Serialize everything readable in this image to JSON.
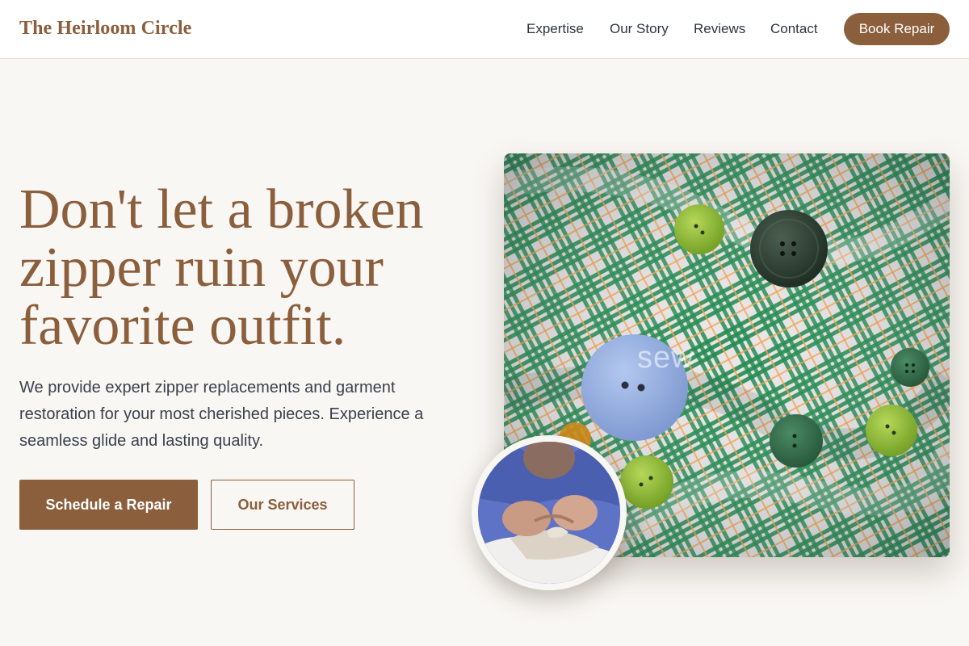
{
  "header": {
    "brand": "The Heirloom Circle",
    "nav": [
      "Expertise",
      "Our Story",
      "Reviews",
      "Contact"
    ],
    "cta": "Book Repair"
  },
  "hero": {
    "title": "Don't let a broken zipper ruin your favorite outfit.",
    "description": "We provide expert zipper replacements and garment restoration for your most cherished pieces. Experience a seamless glide and lasting quality.",
    "primary_button": "Schedule a Repair",
    "secondary_button": "Our Services"
  },
  "images": {
    "main_watermark": "sew"
  },
  "colors": {
    "accent": "#8b5e3c",
    "background": "#f9f7f4",
    "text": "#2f3441"
  }
}
